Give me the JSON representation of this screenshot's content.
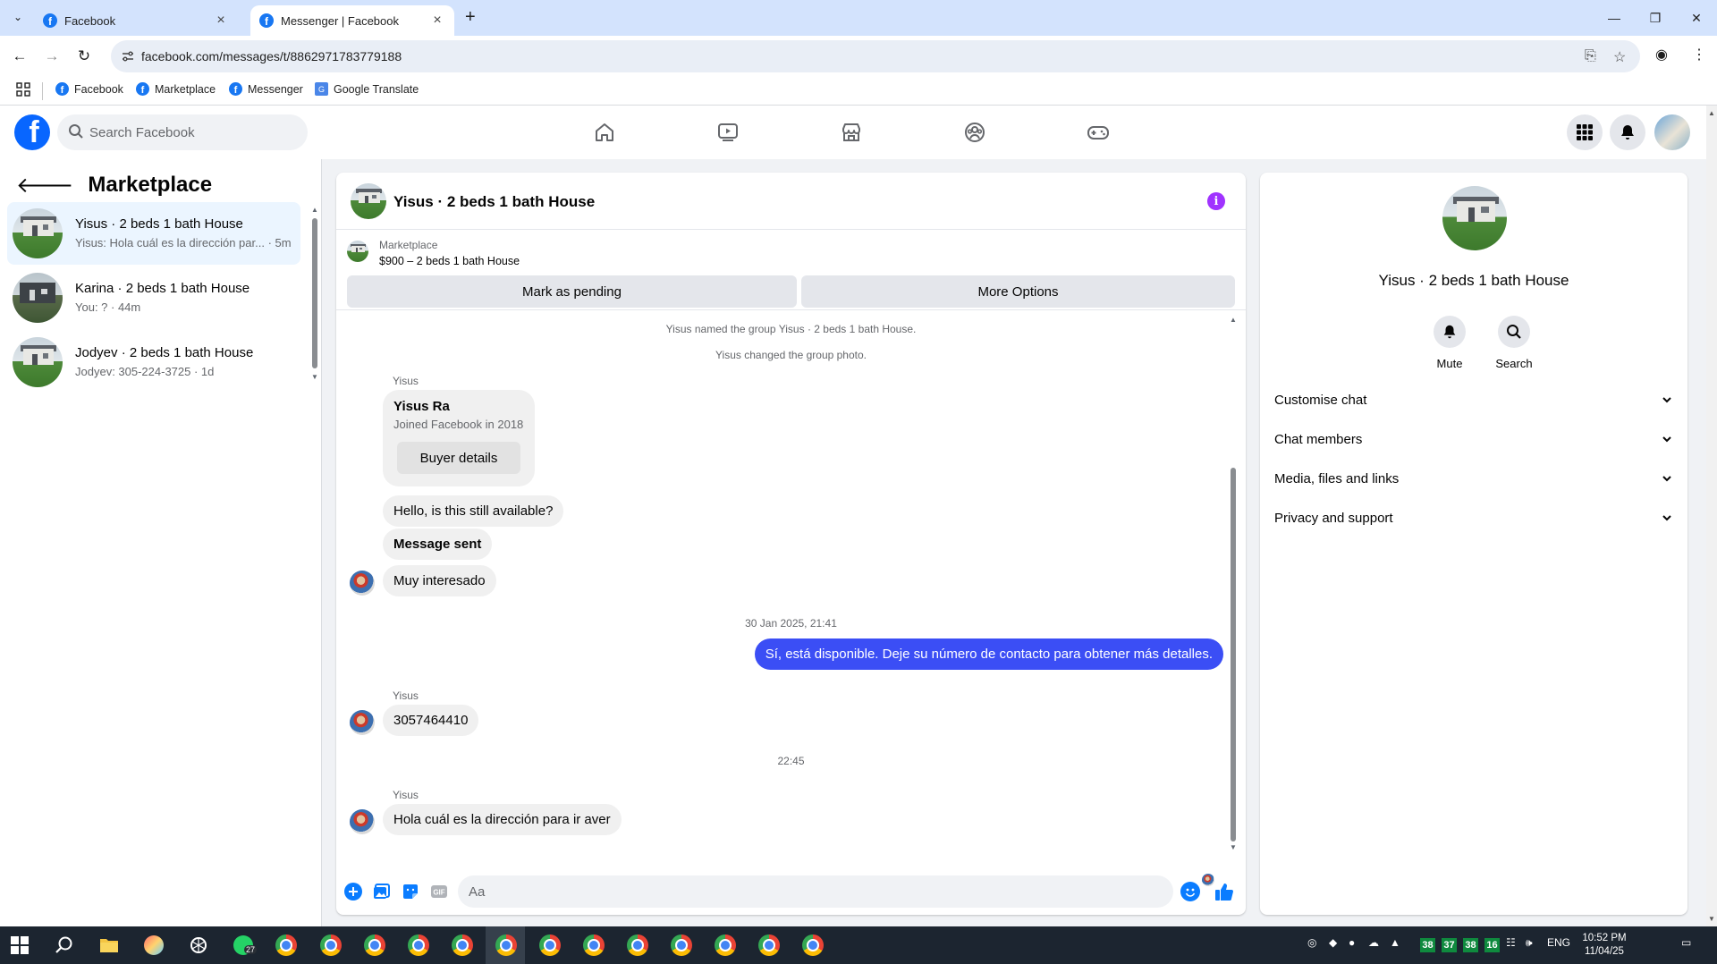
{
  "browser": {
    "tabs": [
      {
        "label": "Facebook",
        "active": false
      },
      {
        "label": "Messenger | Facebook",
        "active": true
      }
    ],
    "url": "facebook.com/messages/t/8862971783779188",
    "bookmarks": [
      "Facebook",
      "Marketplace",
      "Messenger",
      "Google Translate"
    ]
  },
  "fb_header": {
    "search_placeholder": "Search Facebook",
    "nav_icons": [
      "home-icon",
      "video-icon",
      "marketplace-icon",
      "groups-icon",
      "gaming-icon"
    ],
    "brand_color": "#0866ff"
  },
  "left_panel": {
    "title": "Marketplace",
    "conversations": [
      {
        "name": "Yisus · 2 beds 1 bath House",
        "preview": "Yisus: Hola cuál es la dirección par... · 5m",
        "active": true
      },
      {
        "name": "Karina · 2 beds 1 bath House",
        "preview": "You: ? · 44m",
        "active": false
      },
      {
        "name": "Jodyev · 2 beds 1 bath House",
        "preview": "Jodyev: 305-224-3725 · 1d",
        "active": false
      }
    ]
  },
  "chat": {
    "title": "Yisus · 2 beds 1 bath House",
    "marketplace_label": "Marketplace",
    "listing": "$900 – 2 beds 1 bath House",
    "mark_pending": "Mark as pending",
    "more_options": "More Options",
    "system_messages": [
      "Yisus named the group Yisus · 2 beds 1 bath House.",
      "Yisus changed the group photo."
    ],
    "sender_name": "Yisus",
    "buyer_card": {
      "name": "Yisus Ra",
      "joined": "Joined Facebook in 2018",
      "button": "Buyer details"
    },
    "messages": [
      {
        "text": "Hello, is this still available?",
        "direction": "in"
      },
      {
        "text": "Message sent",
        "direction": "in"
      },
      {
        "text": "Muy interesado",
        "direction": "in"
      },
      {
        "text": "Sí, está disponible. Deje su número de contacto para obtener más detalles.",
        "direction": "out"
      },
      {
        "text": "3057464410",
        "direction": "in"
      },
      {
        "text": "Hola cuál es la dirección para ir aver",
        "direction": "in"
      }
    ],
    "timestamps": [
      "30 Jan 2025, 21:41",
      "22:45"
    ],
    "composer_placeholder": "Aa",
    "outgoing_color": "#3b4ef5"
  },
  "info_panel": {
    "title": "Yisus · 2 beds 1 bath House",
    "mute": "Mute",
    "search": "Search",
    "sections": [
      "Customise chat",
      "Chat members",
      "Media, files and links",
      "Privacy and support"
    ]
  },
  "taskbar": {
    "whatsapp_badge": "27",
    "temps": [
      "38",
      "37",
      "38",
      "16"
    ],
    "language": "ENG",
    "time": "10:52 PM",
    "date": "11/04/25"
  }
}
